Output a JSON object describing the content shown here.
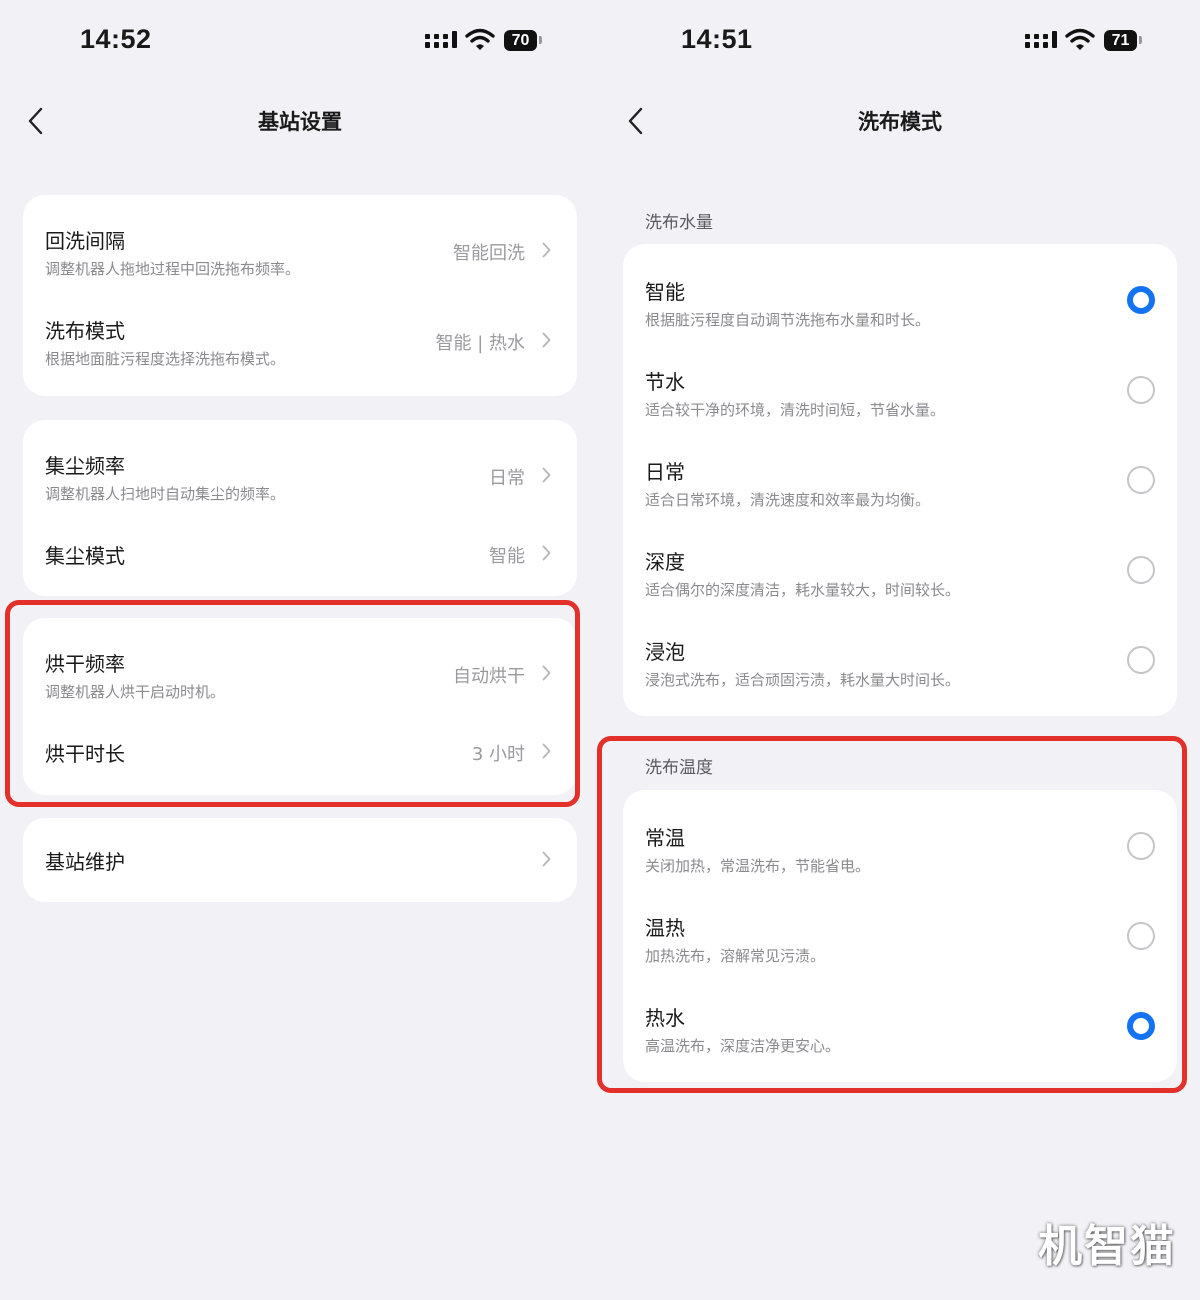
{
  "colors": {
    "background": "#f1f1f6",
    "accent": "#1473f2",
    "highlight": "#e4302a"
  },
  "left": {
    "status": {
      "time": "14:52",
      "battery": "70"
    },
    "title": "基站设置",
    "groups": [
      {
        "items": [
          {
            "title": "回洗间隔",
            "subtitle": "调整机器人拖地过程中回洗拖布频率。",
            "value": "智能回洗"
          },
          {
            "title": "洗布模式",
            "subtitle": "根据地面脏污程度选择洗拖布模式。",
            "value": "智能 | 热水"
          }
        ]
      },
      {
        "items": [
          {
            "title": "集尘频率",
            "subtitle": "调整机器人扫地时自动集尘的频率。",
            "value": "日常"
          },
          {
            "title": "集尘模式",
            "value": "智能"
          }
        ]
      },
      {
        "items": [
          {
            "title": "烘干频率",
            "subtitle": "调整机器人烘干启动时机。",
            "value": "自动烘干"
          },
          {
            "title": "烘干时长",
            "value": "3 小时"
          }
        ]
      },
      {
        "items": [
          {
            "title": "基站维护",
            "value": ""
          }
        ]
      }
    ]
  },
  "right": {
    "status": {
      "time": "14:51",
      "battery": "71"
    },
    "title": "洗布模式",
    "water": {
      "label": "洗布水量",
      "options": [
        {
          "title": "智能",
          "subtitle": "根据脏污程度自动调节洗拖布水量和时长。",
          "selected": true
        },
        {
          "title": "节水",
          "subtitle": "适合较干净的环境，清洗时间短，节省水量。",
          "selected": false
        },
        {
          "title": "日常",
          "subtitle": "适合日常环境，清洗速度和效率最为均衡。",
          "selected": false
        },
        {
          "title": "深度",
          "subtitle": "适合偶尔的深度清洁，耗水量较大，时间较长。",
          "selected": false
        },
        {
          "title": "浸泡",
          "subtitle": "浸泡式洗布，适合顽固污渍，耗水量大时间长。",
          "selected": false
        }
      ]
    },
    "temperature": {
      "label": "洗布温度",
      "options": [
        {
          "title": "常温",
          "subtitle": "关闭加热，常温洗布，节能省电。",
          "selected": false
        },
        {
          "title": "温热",
          "subtitle": "加热洗布，溶解常见污渍。",
          "selected": false
        },
        {
          "title": "热水",
          "subtitle": "高温洗布，深度洁净更安心。",
          "selected": true
        }
      ]
    }
  },
  "watermark": "机智猫"
}
